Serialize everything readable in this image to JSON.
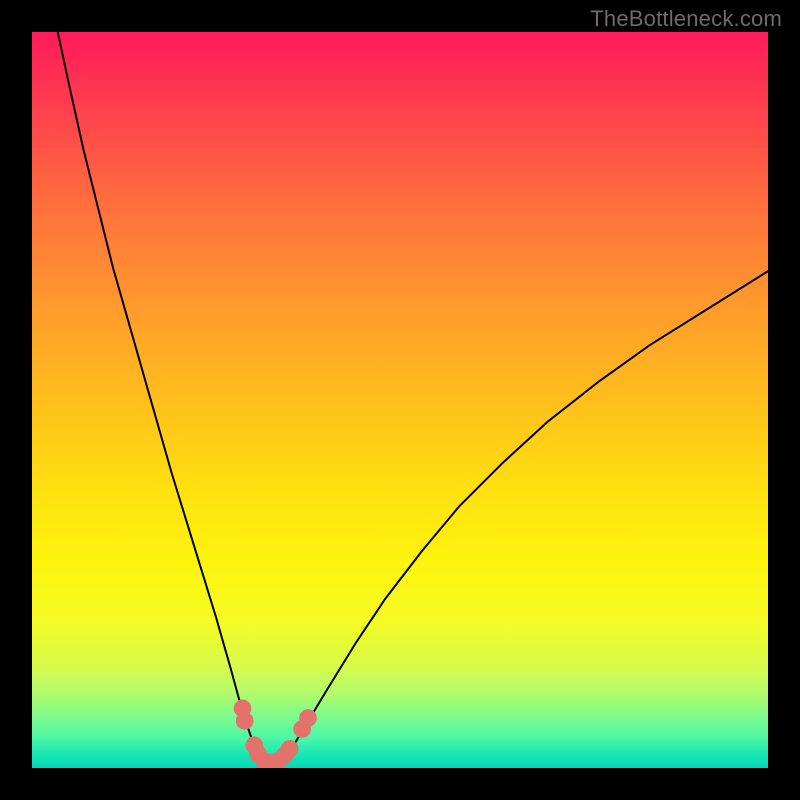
{
  "watermark": "TheBottleneck.com",
  "chart_data": {
    "type": "line",
    "title": "",
    "xlabel": "",
    "ylabel": "",
    "xlim": [
      0,
      100
    ],
    "ylim": [
      0,
      100
    ],
    "background_gradient": {
      "top": "#ff1a5a",
      "middle": "#ffe010",
      "bottom": "#00d8b8"
    },
    "series": [
      {
        "name": "left-branch",
        "stroke": "#000000",
        "stroke_width": 2,
        "x": [
          3.5,
          5,
          7,
          9,
          11,
          13,
          15,
          17,
          19,
          21,
          23,
          25,
          27,
          28.5,
          30,
          31.5
        ],
        "y": [
          100,
          93,
          84,
          76,
          68,
          61,
          54,
          47,
          40,
          33.5,
          27,
          20.5,
          13.5,
          8,
          3.5,
          0.7
        ]
      },
      {
        "name": "right-branch",
        "stroke": "#000000",
        "stroke_width": 2,
        "x": [
          33.5,
          35,
          37,
          40,
          44,
          48,
          53,
          58,
          64,
          70,
          77,
          84,
          92,
          100
        ],
        "y": [
          0.7,
          2.2,
          5.5,
          10.5,
          17,
          23,
          29.5,
          35.5,
          41.5,
          47,
          52.5,
          57.5,
          62.5,
          67.5
        ]
      },
      {
        "name": "valley-floor",
        "stroke": "#000000",
        "stroke_width": 2,
        "x": [
          31.5,
          32.5,
          33.5
        ],
        "y": [
          0.7,
          0.5,
          0.7
        ]
      }
    ],
    "markers": [
      {
        "name": "dot-left-upper-a",
        "x": 28.6,
        "y": 8.1,
        "r": 1.2,
        "fill": "#e2726a"
      },
      {
        "name": "dot-left-upper-b",
        "x": 28.9,
        "y": 6.4,
        "r": 1.2,
        "fill": "#e2726a"
      },
      {
        "name": "dot-left-lower-a",
        "x": 30.2,
        "y": 3.1,
        "r": 1.2,
        "fill": "#e2726a"
      },
      {
        "name": "dot-left-lower-b",
        "x": 30.7,
        "y": 1.9,
        "r": 1.2,
        "fill": "#e2726a"
      },
      {
        "name": "dot-floor-a",
        "x": 31.6,
        "y": 0.9,
        "r": 1.2,
        "fill": "#e2726a"
      },
      {
        "name": "dot-floor-b",
        "x": 32.5,
        "y": 0.7,
        "r": 1.2,
        "fill": "#e2726a"
      },
      {
        "name": "dot-floor-c",
        "x": 33.4,
        "y": 0.9,
        "r": 1.2,
        "fill": "#e2726a"
      },
      {
        "name": "dot-right-lower-a",
        "x": 34.3,
        "y": 1.7,
        "r": 1.2,
        "fill": "#e2726a"
      },
      {
        "name": "dot-right-lower-b",
        "x": 35.0,
        "y": 2.6,
        "r": 1.2,
        "fill": "#e2726a"
      },
      {
        "name": "dot-right-upper-a",
        "x": 36.7,
        "y": 5.3,
        "r": 1.2,
        "fill": "#e2726a"
      },
      {
        "name": "dot-right-upper-b",
        "x": 37.5,
        "y": 6.8,
        "r": 1.2,
        "fill": "#e2726a"
      }
    ]
  }
}
